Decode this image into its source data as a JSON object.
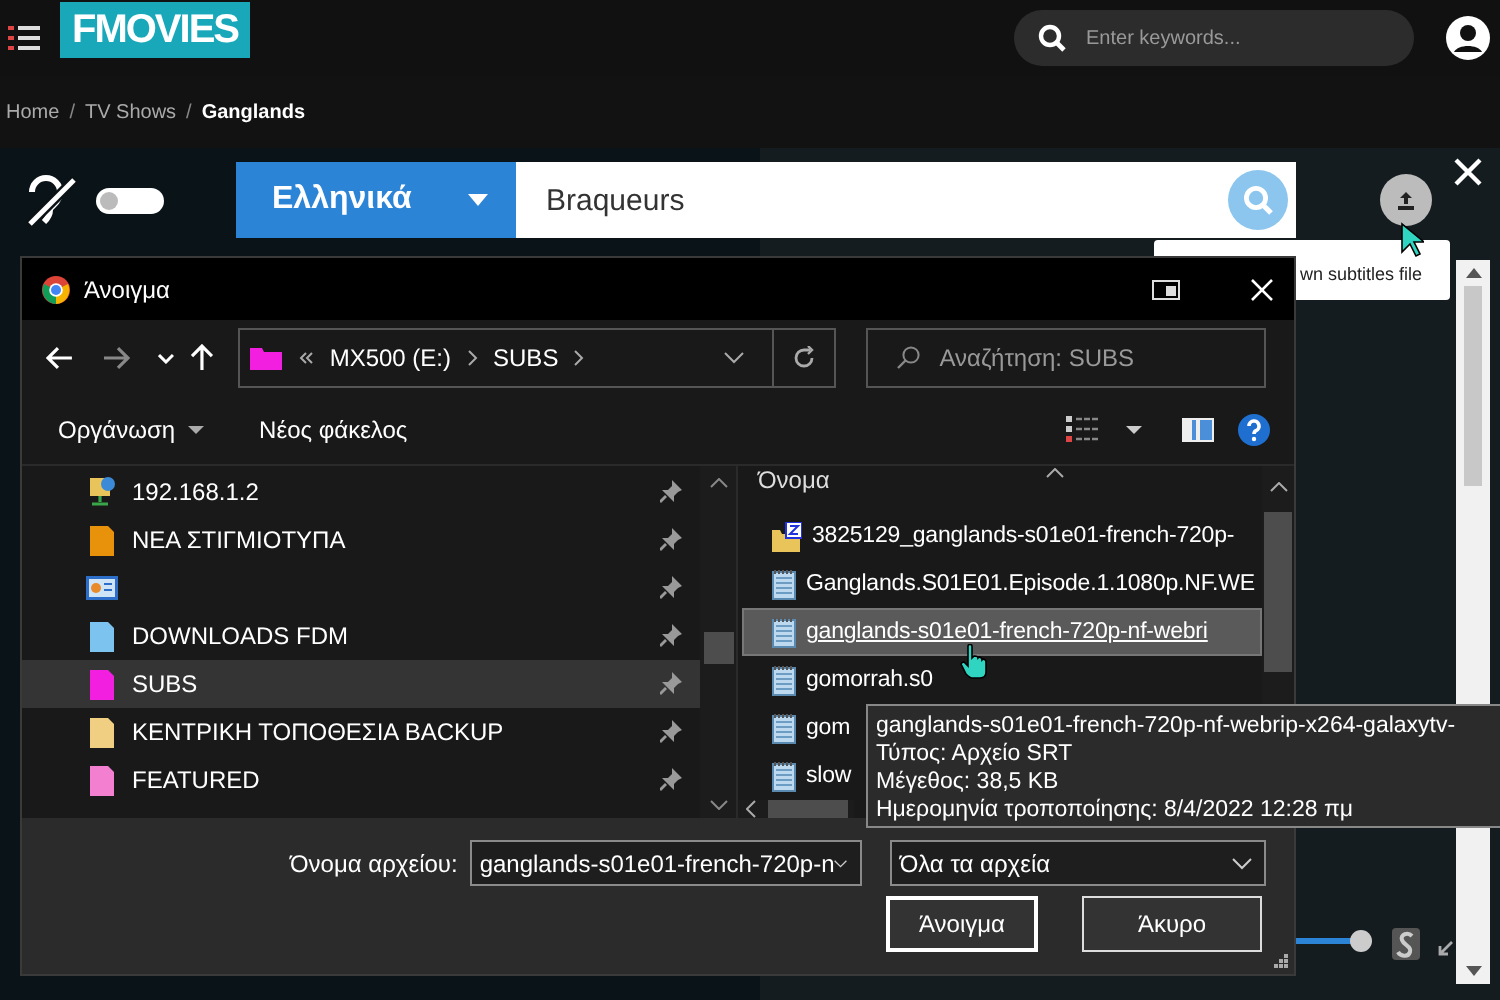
{
  "header": {
    "logo": "FMOVIES",
    "search": {
      "placeholder": "Enter keywords..."
    }
  },
  "breadcrumb": [
    {
      "kind": "link",
      "label": "Home"
    },
    {
      "kind": "sep",
      "label": "/"
    },
    {
      "kind": "link",
      "label": "TV Shows"
    },
    {
      "kind": "sep",
      "label": "/"
    },
    {
      "kind": "current",
      "label": "Ganglands"
    }
  ],
  "subtitle_panel": {
    "hearing_impaired": {
      "on": false
    },
    "language": "Ελληνικά",
    "query": "Braqueurs",
    "upload_tooltip": "wn subtitles file"
  },
  "player": {
    "volume": {
      "level": 0.9
    }
  },
  "dialog": {
    "title": "Άνοιγμα",
    "address": [
      "MX500 (E:)",
      "SUBS"
    ],
    "search": {
      "placeholder": "Αναζήτηση: SUBS"
    },
    "toolbar": {
      "organize": "Οργάνωση",
      "new_folder": "Νέος φάκελος"
    },
    "nav_items": [
      {
        "kind": "network",
        "label": "192.168.1.2",
        "pinned": true,
        "selected": false
      },
      {
        "kind": "folder",
        "color": "#e8920c",
        "label": "ΝΕΑ ΣΤΙΓΜΙΟΤΥΠΑ",
        "pinned": true,
        "selected": false
      },
      {
        "kind": "panel",
        "pinned": true,
        "selected": false
      },
      {
        "kind": "folder",
        "color": "#7cc3f0",
        "label": "DOWNLOADS FDM",
        "pinned": true,
        "selected": false
      },
      {
        "kind": "folder",
        "color": "#f21fe0",
        "label": "SUBS",
        "pinned": true,
        "selected": true
      },
      {
        "kind": "folder",
        "color": "#f0cf82",
        "label": "ΚΕΝΤΡΙΚΗ ΤΟΠΟΘΕΣΙΑ BACKUP",
        "pinned": true,
        "selected": false
      },
      {
        "kind": "folder",
        "color": "#f27fcf",
        "label": "FEATURED",
        "pinned": true,
        "selected": false
      }
    ],
    "column": "Όνομα",
    "files": [
      {
        "kind": "archive",
        "name": "3825129_ganglands-s01e01-french-720p-",
        "selected": false
      },
      {
        "kind": "text",
        "name": "Ganglands.S01E01.Episode.1.1080p.NF.WE",
        "selected": false
      },
      {
        "kind": "text",
        "name": "ganglands-s01e01-french-720p-nf-webri",
        "selected": true
      },
      {
        "kind": "text",
        "name": "gomorrah.s0",
        "selected": false
      },
      {
        "kind": "text",
        "name": "gom",
        "selected": false
      },
      {
        "kind": "text",
        "name": "slow",
        "selected": false
      }
    ],
    "tooltip": [
      "ganglands-s01e01-french-720p-nf-webrip-x264-galaxytv-",
      "Τύπος: Αρχείο SRT",
      "Μέγεθος: 38,5 KB",
      "Ημερομηνία τροποποίησης: 8/4/2022 12:28 πμ"
    ],
    "filename_label": "Όνομα αρχείου:",
    "filename": "ganglands-s01e01-french-720p-n",
    "filter": "Όλα τα αρχεία",
    "buttons": [
      {
        "label": "Άνοιγμα",
        "default": true
      },
      {
        "label": "Άκυρο",
        "default": false
      }
    ]
  }
}
